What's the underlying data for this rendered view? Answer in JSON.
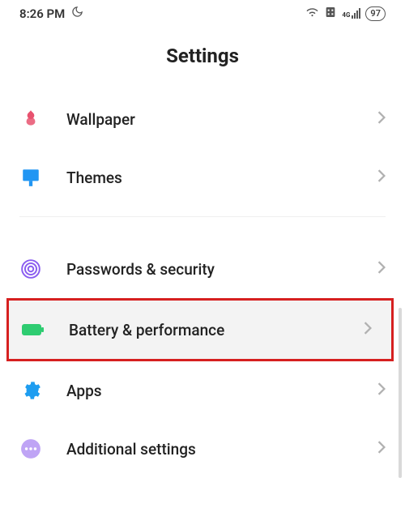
{
  "status": {
    "time": "8:26 PM",
    "battery": "97",
    "network": "4G"
  },
  "header": {
    "title": "Settings"
  },
  "items": {
    "wallpaper": {
      "label": "Wallpaper"
    },
    "themes": {
      "label": "Themes"
    },
    "passwords": {
      "label": "Passwords & security"
    },
    "battery": {
      "label": "Battery & performance"
    },
    "apps": {
      "label": "Apps"
    },
    "additional": {
      "label": "Additional settings"
    }
  }
}
